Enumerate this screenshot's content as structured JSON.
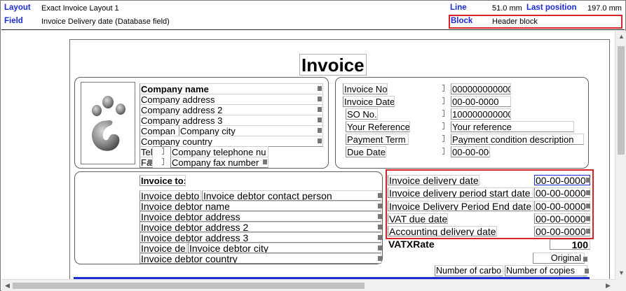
{
  "info": {
    "layout_key": "Layout",
    "layout_val": "Exact Invoice Layout 1",
    "field_key": "Field",
    "field_val": "Invoice Delivery date  (Database field)",
    "line_key": "Line",
    "line_val": "51.0 mm",
    "lastpos_key": "Last position",
    "lastpos_val": "197.0 mm",
    "block_key": "Block",
    "block_val": "Header block"
  },
  "doc": {
    "title": "Invoice",
    "company": {
      "name": "Company name",
      "address": "Company address",
      "address2": "Company address 2",
      "address3": "Company address 3",
      "postcode": "Compan",
      "city": "Company city",
      "country": "Company country",
      "tel_label": "Tel",
      "tel_val": "Company telephone nu",
      "fax_label": "Fax",
      "fax_val": "Company fax number"
    },
    "invoice_meta": [
      {
        "label": "Invoice No.",
        "value": "000000000000"
      },
      {
        "label": "Invoice Date",
        "value": "00-00-0000"
      },
      {
        "label": "SO No.",
        "value": "1000000000000"
      },
      {
        "label": "Your Reference",
        "value": "Your reference"
      },
      {
        "label": "Payment Term",
        "value": "Payment condition description"
      },
      {
        "label": "Due Date",
        "value": "00-00-000"
      }
    ],
    "invoice_to": {
      "label": "Invoice to:",
      "contact_label": "Invoice debto",
      "contact_val": "Invoice debtor contact person",
      "name": "Invoice debtor name",
      "address": "Invoice debtor address",
      "address2": "Invoice debtor address 2",
      "address3": "Invoice debtor address 3",
      "city_label": "Invoice de",
      "city_val": "Invoice debtor city",
      "country": "Invoice debtor country"
    },
    "dates": [
      {
        "label": "Invoice delivery date",
        "value": "00-00-0000"
      },
      {
        "label": "Invoice delivery period start date",
        "value": "00-00-0000"
      },
      {
        "label": "Invoice Delivery Period End date",
        "value": "00-00-0000"
      },
      {
        "label": "VAT due date",
        "value": "00-00-0000"
      },
      {
        "label": "Accounting delivery date",
        "value": "00-00-0000"
      }
    ],
    "vat": {
      "label": "VATXRate",
      "value": "100"
    },
    "original": "Original",
    "number_of_carbon": "Number of carbo",
    "number_of_copies": "Number of copies"
  },
  "colors": {
    "accent": "#1b2bd6",
    "highlight": "#d6232b"
  }
}
